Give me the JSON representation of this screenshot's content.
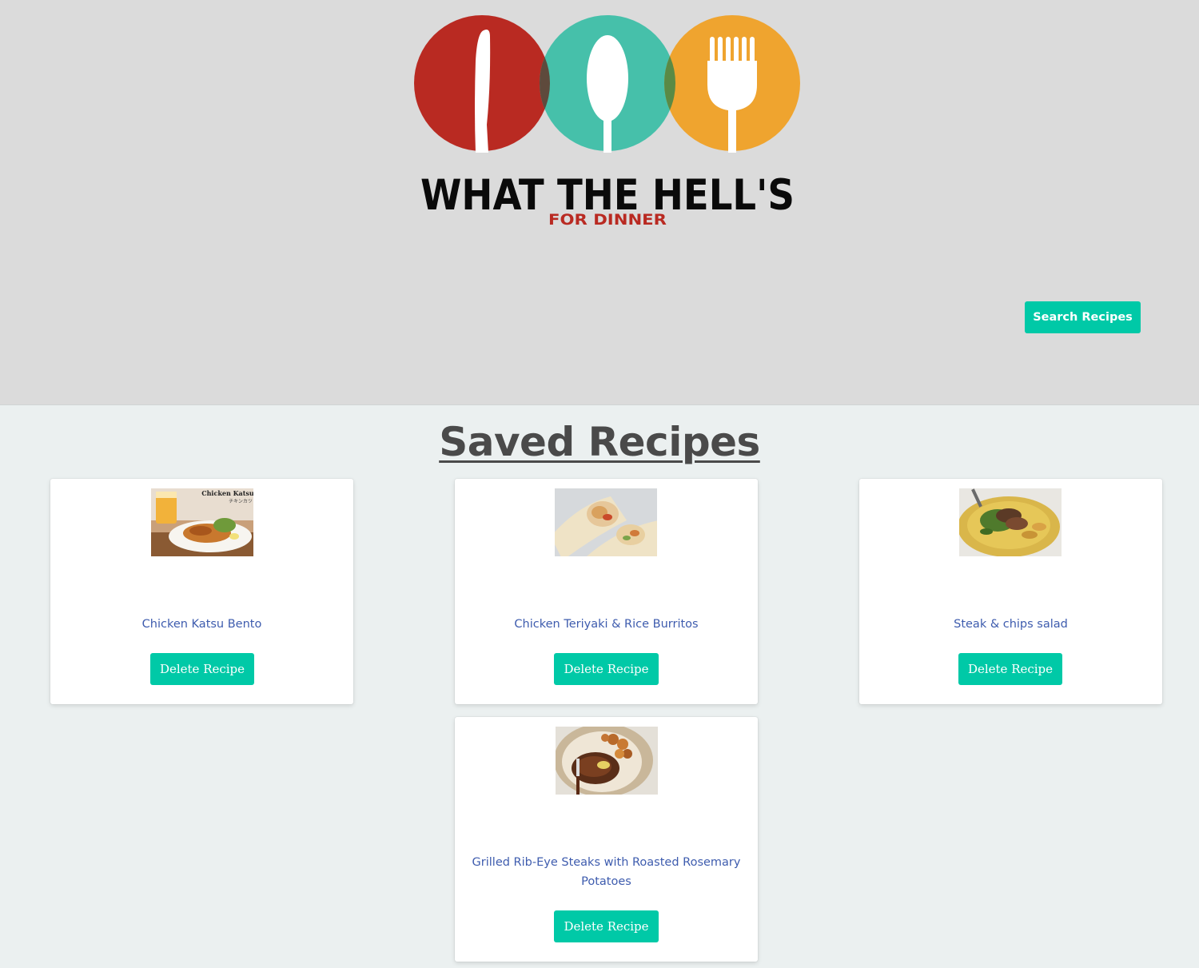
{
  "header": {
    "logo": {
      "line1": "WHAT THE HELL'S",
      "line2": "FOR DINNER",
      "colors": {
        "red": "#b92a22",
        "teal": "#46c0aa",
        "orange": "#efa42f"
      }
    },
    "search_button": "Search Recipes"
  },
  "saved": {
    "title": "Saved Recipes",
    "recipes": [
      {
        "title": "Chicken Katsu Bento",
        "image_caption": "Chicken Katsu",
        "image_caption_jp": "チキンカツ",
        "image_icon": "chicken-katsu-photo",
        "delete_label": "Delete Recipe"
      },
      {
        "title": "Chicken Teriyaki & Rice Burritos",
        "image_icon": "burrito-photo",
        "delete_label": "Delete Recipe"
      },
      {
        "title": "Steak & chips salad",
        "image_icon": "steak-salad-photo",
        "delete_label": "Delete Recipe"
      },
      {
        "title": "Grilled Rib-Eye Steaks with Roasted Rosemary Potatoes",
        "image_icon": "ribeye-steak-photo",
        "delete_label": "Delete Recipe"
      }
    ]
  },
  "colors": {
    "header_bg": "#dbdbdb",
    "page_bg": "#ebf0f0",
    "accent": "#00c9a7",
    "link": "#3e5cae",
    "heading": "#4a4a4a"
  }
}
